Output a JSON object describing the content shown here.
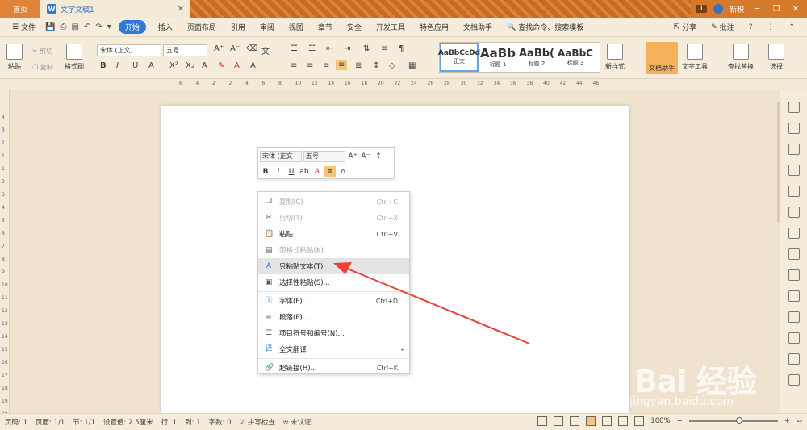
{
  "titlebar": {
    "home_tab": "首页",
    "doc_tab": "文字文稿1",
    "doc_icon": "W",
    "badge": "1",
    "user": "新积"
  },
  "menubar": {
    "file": "文件",
    "start": "开始",
    "tabs": [
      "插入",
      "页面布局",
      "引用",
      "审阅",
      "视图",
      "章节",
      "安全",
      "开发工具",
      "特色应用",
      "文档助手"
    ],
    "search": "查找命令、搜索模板",
    "share": "分享",
    "comment": "批注"
  },
  "ribbon": {
    "paste": "粘贴",
    "cut": "剪切",
    "copy": "复制",
    "format_painter": "格式刷",
    "font_name": "宋体 (正文)",
    "font_size": "五号",
    "styles": [
      {
        "sample": "AaBbCcDd",
        "label": "正文"
      },
      {
        "sample": "AaBb",
        "label": "标题 1"
      },
      {
        "sample": "AaBb(",
        "label": "标题 2"
      },
      {
        "sample": "AaBbC",
        "label": "标题 3"
      }
    ],
    "new_style": "新样式",
    "doc_assistant": "文档助手",
    "text_tools": "文字工具",
    "find_replace": "查找替换",
    "select": "选择"
  },
  "ruler": {
    "h_ticks": [
      "6",
      "4",
      "2",
      "2",
      "4",
      "6",
      "8",
      "10",
      "12",
      "14",
      "16",
      "18",
      "20",
      "22",
      "24",
      "26",
      "28",
      "30",
      "32",
      "34",
      "36",
      "38",
      "40",
      "42",
      "44",
      "46"
    ],
    "v_ticks": [
      "4",
      "3",
      "2",
      "1",
      "1",
      "2",
      "3",
      "4",
      "5",
      "6",
      "7",
      "8",
      "9",
      "10",
      "11",
      "12",
      "13",
      "14",
      "15",
      "16",
      "17",
      "18",
      "19",
      "20"
    ]
  },
  "mini_toolbar": {
    "font_name": "宋体 (正文",
    "font_size": "五号"
  },
  "context_menu": {
    "items": [
      {
        "label": "复制(C)",
        "shortcut": "Ctrl+C",
        "disabled": true,
        "icon": "copy-icon"
      },
      {
        "label": "剪切(T)",
        "shortcut": "Ctrl+X",
        "disabled": true,
        "icon": "scissors-icon"
      },
      {
        "label": "粘贴",
        "shortcut": "Ctrl+V",
        "disabled": false,
        "icon": "paste-icon"
      },
      {
        "label": "带格式粘贴(K)",
        "shortcut": "",
        "disabled": true,
        "icon": "paste-format-icon"
      },
      {
        "label": "只粘贴文本(T)",
        "shortcut": "",
        "disabled": false,
        "icon": "paste-text-icon",
        "highlighted": true
      },
      {
        "label": "选择性粘贴(S)...",
        "shortcut": "",
        "disabled": false,
        "icon": "paste-special-icon"
      },
      {
        "label": "字体(F)...",
        "shortcut": "Ctrl+D",
        "disabled": false,
        "icon": "font-icon"
      },
      {
        "label": "段落(P)...",
        "shortcut": "",
        "disabled": false,
        "icon": "paragraph-icon"
      },
      {
        "label": "项目符号和编号(N)...",
        "shortcut": "",
        "disabled": false,
        "icon": "list-icon"
      },
      {
        "label": "全文翻译",
        "shortcut": "",
        "disabled": false,
        "icon": "translate-icon",
        "submenu": true
      },
      {
        "label": "超链接(H)...",
        "shortcut": "Ctrl+K",
        "disabled": false,
        "icon": "link-icon"
      }
    ]
  },
  "status": {
    "page_num": "页码: 1",
    "pages": "页面: 1/1",
    "section": "节: 1/1",
    "setting": "设置值: 2.5厘米",
    "row": "行: 1",
    "col": "列: 1",
    "words": "字数: 0",
    "spell": "拼写检查",
    "auth": "未认证",
    "zoom": "100%"
  },
  "watermark": {
    "main": "Bai 经验",
    "sub": "jingyan.baidu.com"
  },
  "colors": {
    "accent_blue": "#2f7ad8",
    "arrow_red": "#e8403a",
    "title_orange": "#d57a2a"
  }
}
